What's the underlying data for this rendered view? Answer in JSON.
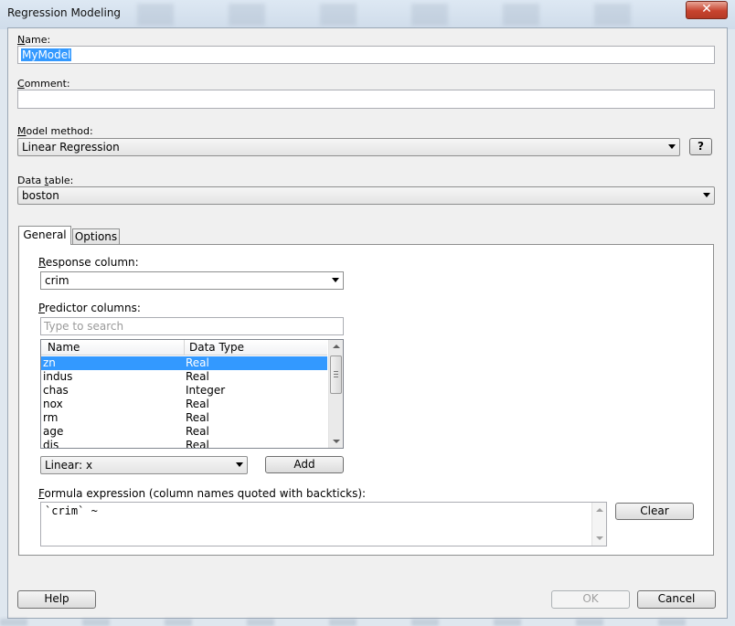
{
  "window": {
    "title": "Regression Modeling",
    "close_glyph": "✕"
  },
  "name": {
    "label": "Name:",
    "value": "MyModel"
  },
  "comment": {
    "label": "Comment:",
    "value": ""
  },
  "model_method": {
    "label": "Model method:",
    "value": "Linear Regression",
    "help_label": "?"
  },
  "data_table": {
    "label": "Data table:",
    "value": "boston"
  },
  "tabs": [
    {
      "label": "General",
      "active": true
    },
    {
      "label": "Options",
      "active": false
    }
  ],
  "general": {
    "response": {
      "label": "Response column:",
      "value": "crim"
    },
    "predictors": {
      "label": "Predictor columns:",
      "search_placeholder": "Type to search",
      "columns": [
        "Name",
        "Data Type"
      ],
      "rows": [
        {
          "name": "zn",
          "type": "Real",
          "selected": true
        },
        {
          "name": "indus",
          "type": "Real",
          "selected": false
        },
        {
          "name": "chas",
          "type": "Integer",
          "selected": false
        },
        {
          "name": "nox",
          "type": "Real",
          "selected": false
        },
        {
          "name": "rm",
          "type": "Real",
          "selected": false
        },
        {
          "name": "age",
          "type": "Real",
          "selected": false
        },
        {
          "name": "dis",
          "type": "Real",
          "selected": false
        }
      ]
    },
    "term_type": {
      "value": "Linear: x"
    },
    "add_label": "Add",
    "formula": {
      "label": "Formula expression (column names quoted with backticks):",
      "value": "`crim` ~"
    },
    "clear_label": "Clear"
  },
  "footer": {
    "help_label": "Help",
    "ok_label": "OK",
    "cancel_label": "Cancel"
  }
}
